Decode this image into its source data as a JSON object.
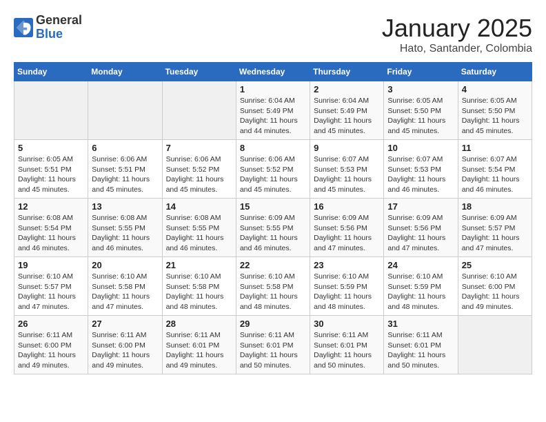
{
  "logo": {
    "general": "General",
    "blue": "Blue"
  },
  "header": {
    "title": "January 2025",
    "subtitle": "Hato, Santander, Colombia"
  },
  "days_of_week": [
    "Sunday",
    "Monday",
    "Tuesday",
    "Wednesday",
    "Thursday",
    "Friday",
    "Saturday"
  ],
  "weeks": [
    [
      {
        "day": "",
        "info": ""
      },
      {
        "day": "",
        "info": ""
      },
      {
        "day": "",
        "info": ""
      },
      {
        "day": "1",
        "info": "Sunrise: 6:04 AM\nSunset: 5:49 PM\nDaylight: 11 hours\nand 44 minutes."
      },
      {
        "day": "2",
        "info": "Sunrise: 6:04 AM\nSunset: 5:49 PM\nDaylight: 11 hours\nand 45 minutes."
      },
      {
        "day": "3",
        "info": "Sunrise: 6:05 AM\nSunset: 5:50 PM\nDaylight: 11 hours\nand 45 minutes."
      },
      {
        "day": "4",
        "info": "Sunrise: 6:05 AM\nSunset: 5:50 PM\nDaylight: 11 hours\nand 45 minutes."
      }
    ],
    [
      {
        "day": "5",
        "info": "Sunrise: 6:05 AM\nSunset: 5:51 PM\nDaylight: 11 hours\nand 45 minutes."
      },
      {
        "day": "6",
        "info": "Sunrise: 6:06 AM\nSunset: 5:51 PM\nDaylight: 11 hours\nand 45 minutes."
      },
      {
        "day": "7",
        "info": "Sunrise: 6:06 AM\nSunset: 5:52 PM\nDaylight: 11 hours\nand 45 minutes."
      },
      {
        "day": "8",
        "info": "Sunrise: 6:06 AM\nSunset: 5:52 PM\nDaylight: 11 hours\nand 45 minutes."
      },
      {
        "day": "9",
        "info": "Sunrise: 6:07 AM\nSunset: 5:53 PM\nDaylight: 11 hours\nand 45 minutes."
      },
      {
        "day": "10",
        "info": "Sunrise: 6:07 AM\nSunset: 5:53 PM\nDaylight: 11 hours\nand 46 minutes."
      },
      {
        "day": "11",
        "info": "Sunrise: 6:07 AM\nSunset: 5:54 PM\nDaylight: 11 hours\nand 46 minutes."
      }
    ],
    [
      {
        "day": "12",
        "info": "Sunrise: 6:08 AM\nSunset: 5:54 PM\nDaylight: 11 hours\nand 46 minutes."
      },
      {
        "day": "13",
        "info": "Sunrise: 6:08 AM\nSunset: 5:55 PM\nDaylight: 11 hours\nand 46 minutes."
      },
      {
        "day": "14",
        "info": "Sunrise: 6:08 AM\nSunset: 5:55 PM\nDaylight: 11 hours\nand 46 minutes."
      },
      {
        "day": "15",
        "info": "Sunrise: 6:09 AM\nSunset: 5:55 PM\nDaylight: 11 hours\nand 46 minutes."
      },
      {
        "day": "16",
        "info": "Sunrise: 6:09 AM\nSunset: 5:56 PM\nDaylight: 11 hours\nand 47 minutes."
      },
      {
        "day": "17",
        "info": "Sunrise: 6:09 AM\nSunset: 5:56 PM\nDaylight: 11 hours\nand 47 minutes."
      },
      {
        "day": "18",
        "info": "Sunrise: 6:09 AM\nSunset: 5:57 PM\nDaylight: 11 hours\nand 47 minutes."
      }
    ],
    [
      {
        "day": "19",
        "info": "Sunrise: 6:10 AM\nSunset: 5:57 PM\nDaylight: 11 hours\nand 47 minutes."
      },
      {
        "day": "20",
        "info": "Sunrise: 6:10 AM\nSunset: 5:58 PM\nDaylight: 11 hours\nand 47 minutes."
      },
      {
        "day": "21",
        "info": "Sunrise: 6:10 AM\nSunset: 5:58 PM\nDaylight: 11 hours\nand 48 minutes."
      },
      {
        "day": "22",
        "info": "Sunrise: 6:10 AM\nSunset: 5:58 PM\nDaylight: 11 hours\nand 48 minutes."
      },
      {
        "day": "23",
        "info": "Sunrise: 6:10 AM\nSunset: 5:59 PM\nDaylight: 11 hours\nand 48 minutes."
      },
      {
        "day": "24",
        "info": "Sunrise: 6:10 AM\nSunset: 5:59 PM\nDaylight: 11 hours\nand 48 minutes."
      },
      {
        "day": "25",
        "info": "Sunrise: 6:10 AM\nSunset: 6:00 PM\nDaylight: 11 hours\nand 49 minutes."
      }
    ],
    [
      {
        "day": "26",
        "info": "Sunrise: 6:11 AM\nSunset: 6:00 PM\nDaylight: 11 hours\nand 49 minutes."
      },
      {
        "day": "27",
        "info": "Sunrise: 6:11 AM\nSunset: 6:00 PM\nDaylight: 11 hours\nand 49 minutes."
      },
      {
        "day": "28",
        "info": "Sunrise: 6:11 AM\nSunset: 6:01 PM\nDaylight: 11 hours\nand 49 minutes."
      },
      {
        "day": "29",
        "info": "Sunrise: 6:11 AM\nSunset: 6:01 PM\nDaylight: 11 hours\nand 50 minutes."
      },
      {
        "day": "30",
        "info": "Sunrise: 6:11 AM\nSunset: 6:01 PM\nDaylight: 11 hours\nand 50 minutes."
      },
      {
        "day": "31",
        "info": "Sunrise: 6:11 AM\nSunset: 6:01 PM\nDaylight: 11 hours\nand 50 minutes."
      },
      {
        "day": "",
        "info": ""
      }
    ]
  ]
}
